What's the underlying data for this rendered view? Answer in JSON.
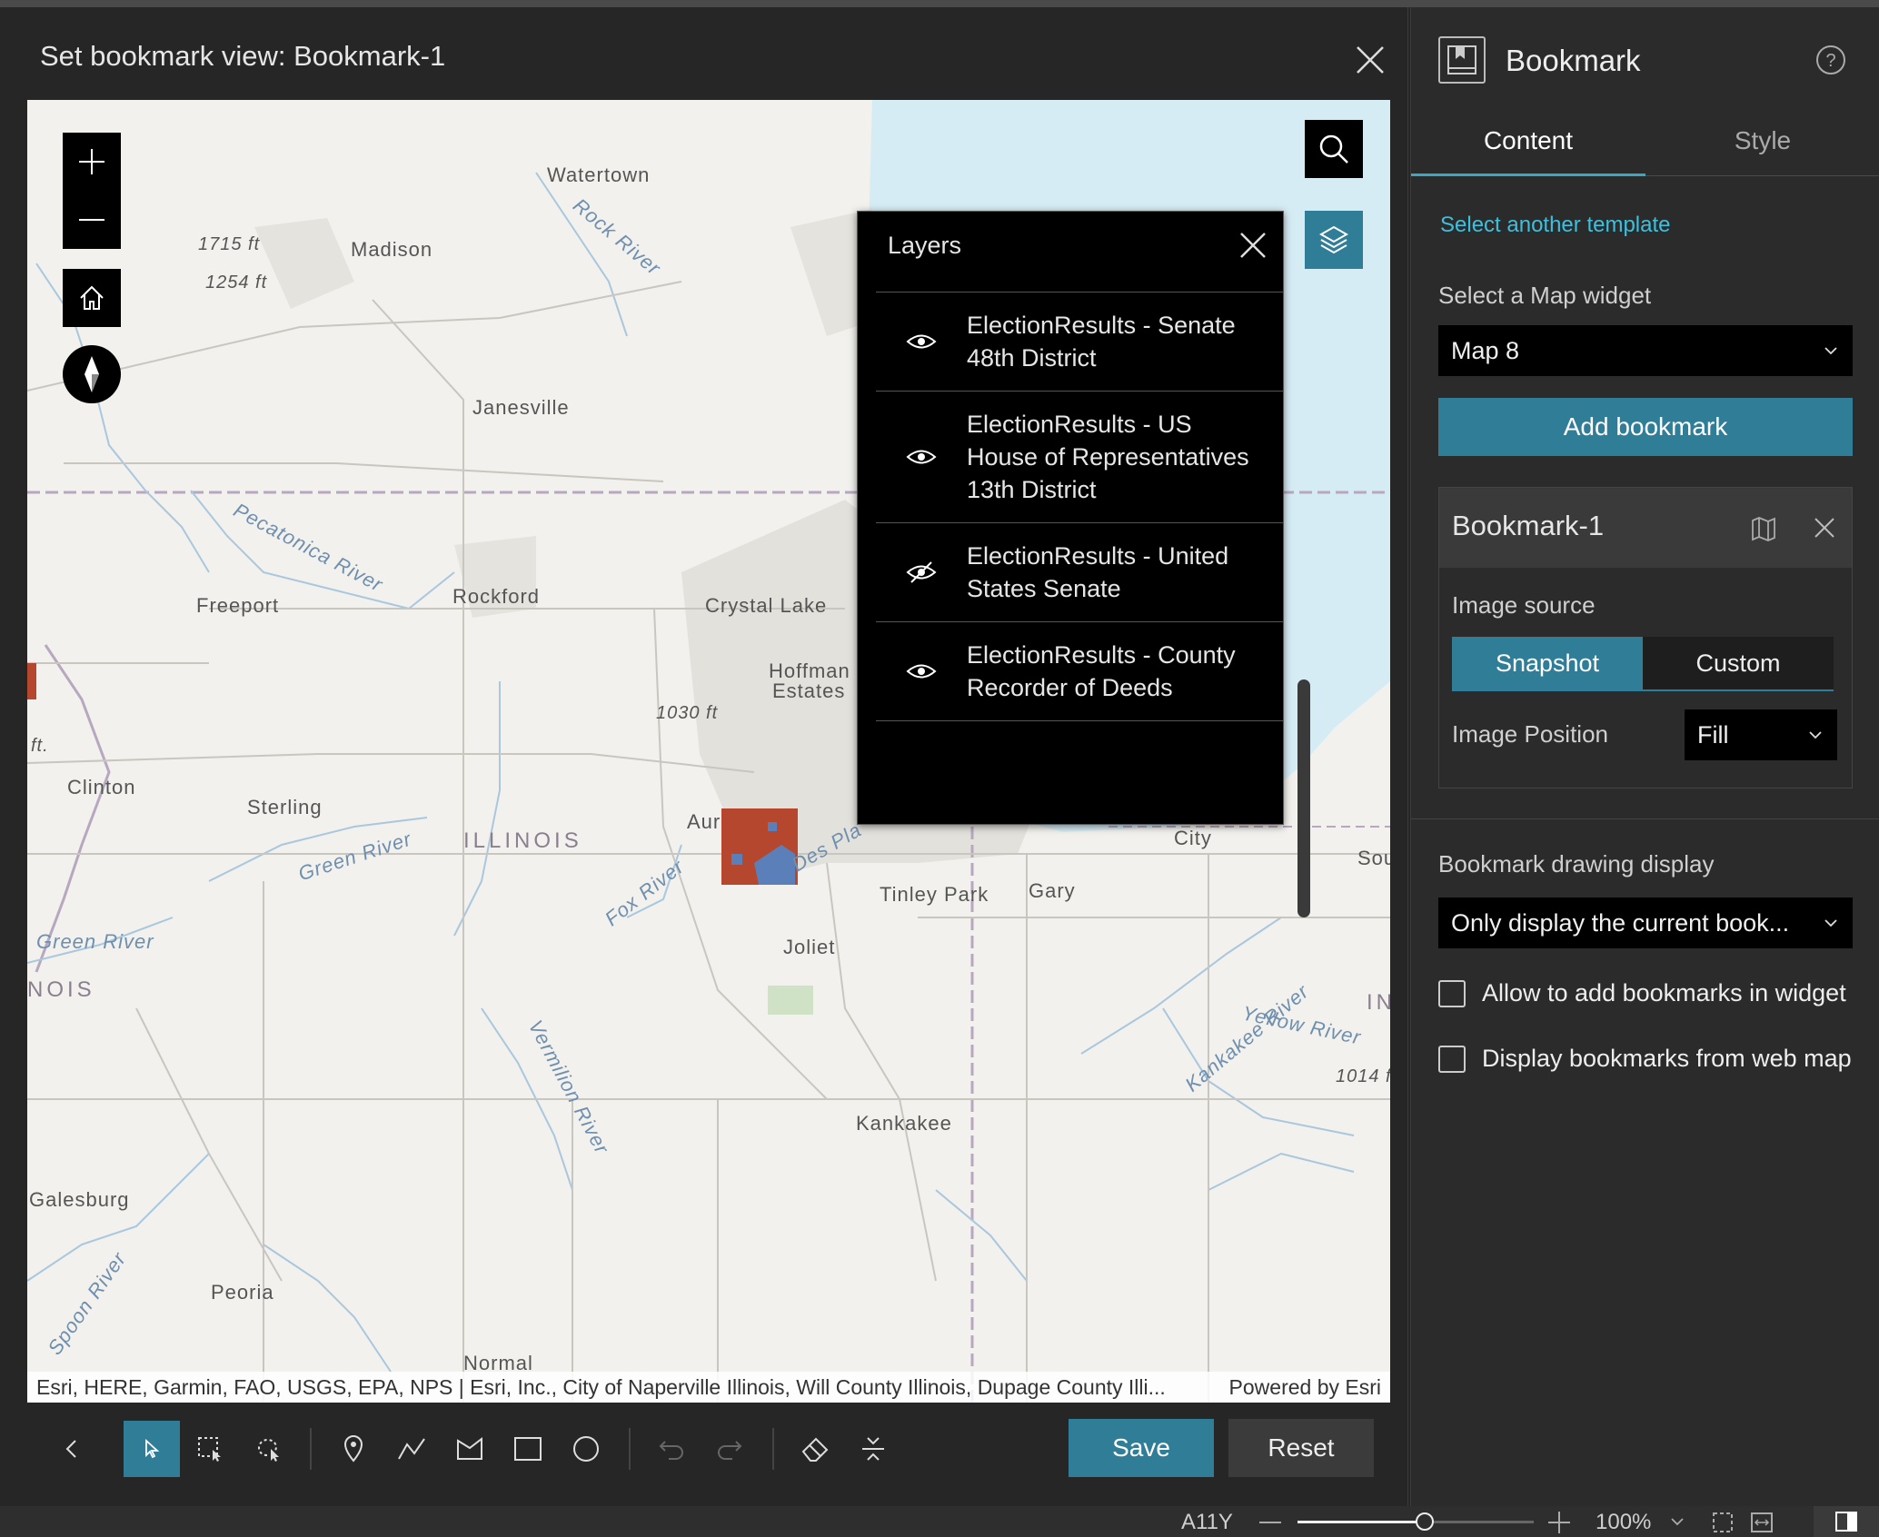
{
  "dialog": {
    "title": "Set bookmark view: Bookmark-1",
    "save_label": "Save",
    "reset_label": "Reset"
  },
  "map": {
    "labels": {
      "watertown": "Watertown",
      "madison": "Madison",
      "elev1715": "1715 ft",
      "elev1254": "1254 ft",
      "janesville": "Janesville",
      "rockford": "Rockford",
      "freeport": "Freeport",
      "crystal_lake": "Crystal Lake",
      "hoffman": "Hoffman",
      "estates": "Estates",
      "elev1030": "1030 ft",
      "clinton": "Clinton",
      "sterling": "Sterling",
      "illinois": "ILLINOIS",
      "aurora_partial": "Aur",
      "tinley_park": "Tinley Park",
      "gary": "Gary",
      "joliet": "Joliet",
      "kankakee": "Kankakee",
      "galesburg": "Galesburg",
      "peoria": "Peoria",
      "normal": "Normal",
      "nois_partial": "NOIS",
      "city_partial": "City",
      "sou_partial": "Sou",
      "in_partial": "IN",
      "elev1014": "1014 f",
      "ft_partial": "ft.",
      "rock_river": "Rock River",
      "pecatonica_river": "Pecatonica River",
      "green_river": "Green River",
      "green_river2": "Green River",
      "fox_river": "Fox River",
      "vermilion_river": "Vermilion River",
      "kankakee_river": "Kankakee River",
      "yellow_river": "Yellow River",
      "spoon_river": "Spoon River",
      "des_plaines": "Des Pla"
    },
    "attribution": "Esri, HERE, Garmin, FAO, USGS, EPA, NPS | Esri, Inc., City of Naperville Illinois, Will County Illinois, Dupage County Illi...",
    "powered_by": "Powered by Esri"
  },
  "layers_panel": {
    "title": "Layers",
    "items": [
      {
        "label": "ElectionResults - Senate 48th District",
        "visible": true
      },
      {
        "label": "ElectionResults - US House of Representatives 13th District",
        "visible": true
      },
      {
        "label": "ElectionResults - United States Senate",
        "visible": false
      },
      {
        "label": "ElectionResults - County Recorder of Deeds",
        "visible": true
      }
    ]
  },
  "right_panel": {
    "title": "Bookmark",
    "tabs": [
      "Content",
      "Style"
    ],
    "active_tab": "Content",
    "select_template_link": "Select another template",
    "map_widget_label": "Select a Map widget",
    "map_widget_value": "Map 8",
    "add_bookmark_label": "Add bookmark",
    "bookmark": {
      "name": "Bookmark-1",
      "image_source_label": "Image source",
      "image_source_options": [
        "Snapshot",
        "Custom"
      ],
      "image_source_selected": "Snapshot",
      "image_position_label": "Image Position",
      "image_position_value": "Fill"
    },
    "drawing_display_label": "Bookmark drawing display",
    "drawing_display_value": "Only display the current book...",
    "checkboxes": [
      {
        "label": "Allow to add bookmarks in widget",
        "checked": false
      },
      {
        "label": "Display bookmarks from web map",
        "checked": false
      }
    ]
  },
  "status_bar": {
    "a11y": "A11Y",
    "zoom": "100%"
  },
  "colors": {
    "accent": "#2f7d97",
    "link": "#3cc0de",
    "election_red": "#b5472e",
    "election_blue": "#5b7fb8"
  }
}
